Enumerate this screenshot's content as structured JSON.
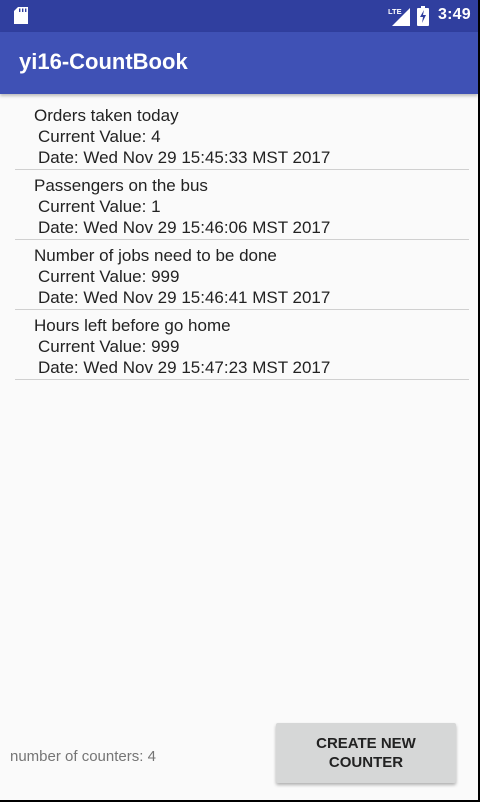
{
  "status_bar": {
    "time": "3:49",
    "network": "LTE",
    "icons": [
      "sd-card-icon",
      "lte-signal-icon",
      "battery-charging-icon"
    ]
  },
  "app_bar": {
    "title": "yi16-CountBook"
  },
  "counters": [
    {
      "name": "Orders taken today",
      "value_text": "Current Value: 4",
      "date_text": "Date: Wed Nov 29 15:45:33 MST 2017"
    },
    {
      "name": "Passengers on the bus",
      "value_text": "Current Value: 1",
      "date_text": "Date: Wed Nov 29 15:46:06 MST 2017"
    },
    {
      "name": "Number of jobs need to be done",
      "value_text": "Current Value: 999",
      "date_text": "Date: Wed Nov 29 15:46:41 MST 2017"
    },
    {
      "name": "Hours left before go home",
      "value_text": "Current Value: 999",
      "date_text": "Date: Wed Nov 29 15:47:23 MST 2017"
    }
  ],
  "footer": {
    "counter_count": "number of counters: 4",
    "create_button_label": "CREATE NEW COUNTER"
  },
  "colors": {
    "status_bar": "#303f9f",
    "app_bar": "#3f51b5",
    "background": "#fafafa",
    "button": "#d6d7d7"
  }
}
